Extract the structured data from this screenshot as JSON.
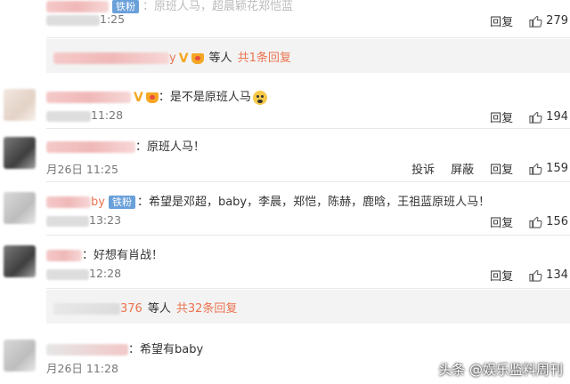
{
  "comments": [
    {
      "id": "c0",
      "text": "：原班人马，超晨颖花郑恺蓝",
      "badge": "铁粉",
      "time": "1:25",
      "actions": [
        "回复"
      ],
      "likes": "279"
    },
    {
      "id": "c1",
      "text": "：是不是原班人马",
      "time": "11:28",
      "actions": [
        "回复"
      ],
      "likes": "194"
    },
    {
      "id": "c2",
      "text": "：原班人马！",
      "time": "月26日 11:25",
      "actions": [
        "投诉",
        "屏蔽",
        "回复"
      ],
      "likes": "159"
    },
    {
      "id": "c3",
      "name_tail": "by",
      "badge": "铁粉",
      "text": "：希望是邓超，baby，李晨，郑恺，陈赫，鹿晗，王祖蓝原班人马！",
      "time": "13:23",
      "actions": [
        "回复"
      ],
      "likes": "156"
    },
    {
      "id": "c4",
      "text": "：好想有肖战！",
      "time": "12:28",
      "actions": [
        "回复"
      ],
      "likes": "134"
    },
    {
      "id": "c5",
      "text": "：希望有baby",
      "time": "月26日 11:28",
      "actions": [],
      "likes": ""
    }
  ],
  "subbars": [
    {
      "id": "s1",
      "name_tail": "y",
      "people_label": "等人",
      "reply_link": "共1条回复"
    },
    {
      "id": "s2",
      "name_tail": "376",
      "people_label": "等人",
      "reply_link": "共32条回复"
    }
  ],
  "watermark": "头条 @娱乐监料周刊",
  "colors": {
    "accent": "#eb7350",
    "badge": "#6aa0d9",
    "vip": "#f5a623"
  }
}
